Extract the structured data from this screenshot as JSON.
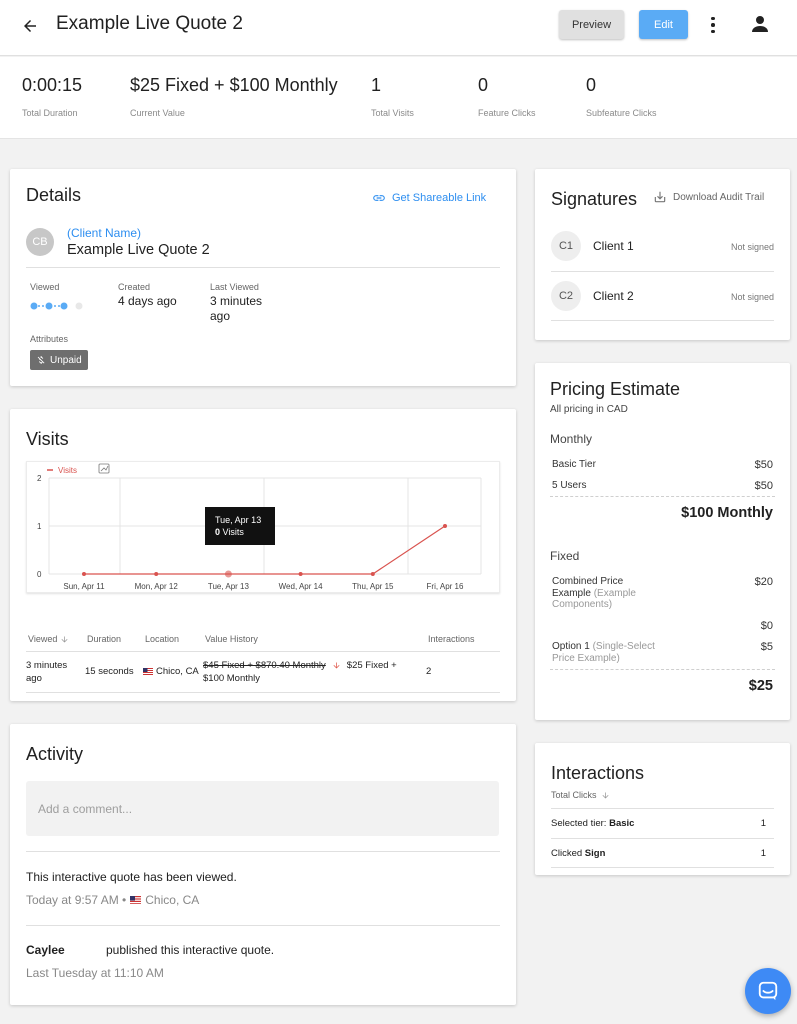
{
  "header": {
    "title": "Example Live Quote 2",
    "preview_label": "Preview",
    "edit_label": "Edit"
  },
  "stats": [
    {
      "value": "0:00:15",
      "label": "Total Duration"
    },
    {
      "value": "$25 Fixed + $100 Monthly",
      "label": "Current Value"
    },
    {
      "value": "1",
      "label": "Total Visits"
    },
    {
      "value": "0",
      "label": "Feature Clicks"
    },
    {
      "value": "0",
      "label": "Subfeature Clicks"
    }
  ],
  "details": {
    "title": "Details",
    "share_link": "Get Shareable Link",
    "avatar_initials": "CB",
    "client_name": "(Client Name)",
    "quote_name": "Example Live Quote 2",
    "viewed_label": "Viewed",
    "created_label": "Created",
    "created_value": "4 days ago",
    "last_viewed_label": "Last Viewed",
    "last_viewed_value_1": "3 minutes",
    "last_viewed_value_2": "ago",
    "attributes_label": "Attributes",
    "badge": "Unpaid"
  },
  "visits": {
    "title": "Visits",
    "tooltip_date": "Tue, Apr 13",
    "tooltip_count": "0",
    "tooltip_suffix": "Visits",
    "table": {
      "headers": [
        "Viewed",
        "Duration",
        "Location",
        "Value History",
        "Interactions"
      ],
      "row": {
        "viewed_1": "3 minutes",
        "viewed_2": "ago",
        "duration": "15 seconds",
        "location": "Chico, CA",
        "old_value": "$45 Fixed + $870.40 Monthly",
        "new_value_1": "$25 Fixed +",
        "new_value_2": "$100 Monthly",
        "interactions": "2"
      }
    }
  },
  "chart_data": {
    "type": "line",
    "categories": [
      "Sun, Apr 11",
      "Mon, Apr 12",
      "Tue, Apr 13",
      "Wed, Apr 14",
      "Thu, Apr 15",
      "Fri, Apr 16"
    ],
    "series": [
      {
        "name": "Visits",
        "values": [
          0,
          0,
          0,
          0,
          0,
          1
        ]
      }
    ],
    "yticks": [
      "0",
      "1",
      "2"
    ],
    "ylim": [
      0,
      2
    ],
    "grid": true,
    "legend": "top-left",
    "color": "#d9534f"
  },
  "activity": {
    "title": "Activity",
    "comment_placeholder": "Add a comment...",
    "items": [
      {
        "text": "This interactive quote has been viewed.",
        "meta_time": "Today at 9:57 AM •",
        "meta_location": "Chico, CA"
      },
      {
        "actor": "Caylee",
        "text": "published this interactive quote.",
        "meta_time": "Last Tuesday at 11:10 AM"
      }
    ]
  },
  "signatures": {
    "title": "Signatures",
    "download": "Download Audit Trail",
    "signers": [
      {
        "initials": "C1",
        "name": "Client 1",
        "status": "Not signed"
      },
      {
        "initials": "C2",
        "name": "Client 2",
        "status": "Not signed"
      }
    ]
  },
  "pricing": {
    "title": "Pricing Estimate",
    "subtitle": "All pricing in CAD",
    "monthly_label": "Monthly",
    "monthly_items": [
      {
        "name": "Basic Tier",
        "price": "$50"
      },
      {
        "name": "5 Users",
        "price": "$50"
      }
    ],
    "monthly_total": "$100 Monthly",
    "fixed_label": "Fixed",
    "fixed_item1_name_1": "Combined Price",
    "fixed_item1_name_2": "Example",
    "fixed_item1_sub_1": "(Example",
    "fixed_item1_sub_2": "Components)",
    "fixed_item1_price": "$20",
    "fixed_item1_price2": "$0",
    "fixed_item2_name": "Option 1",
    "fixed_item2_sub_1": "(Single-Select",
    "fixed_item2_sub_2": "Price Example)",
    "fixed_item2_price": "$5",
    "fixed_total": "$25"
  },
  "interactions": {
    "title": "Interactions",
    "sort_label": "Total Clicks",
    "items": [
      {
        "prefix": "Selected tier:",
        "bold": "Basic",
        "count": "1"
      },
      {
        "prefix": "Clicked",
        "bold": "Sign",
        "count": "1"
      }
    ]
  }
}
